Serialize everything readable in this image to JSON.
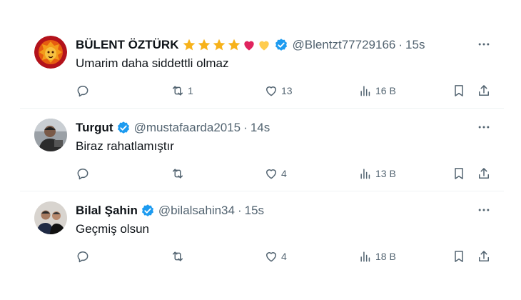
{
  "tweets": [
    {
      "name": "BÜLENT ÖZTÜRK",
      "badges": [
        "star",
        "star",
        "star",
        "star",
        "red-heart",
        "yellow-heart"
      ],
      "handle": "@Blentzt77729166",
      "time": "15s",
      "text": "Umarim daha siddettli olmaz",
      "replies": "",
      "retweets": "1",
      "likes": "13",
      "views": "16 B",
      "avatar": "lion-logo"
    },
    {
      "name": "Turgut",
      "badges": [],
      "handle": "@mustafaarda2015",
      "time": "14s",
      "text": "Biraz rahatlamıştır",
      "replies": "",
      "retweets": "",
      "likes": "4",
      "views": "13 B",
      "avatar": "photo"
    },
    {
      "name": "Bilal Şahin",
      "badges": [],
      "handle": "@bilalsahin34",
      "time": "15s",
      "text": "Geçmiş olsun",
      "replies": "",
      "retweets": "",
      "likes": "4",
      "views": "18 B",
      "avatar": "photo"
    }
  ],
  "separator": "·",
  "colors": {
    "text": "#0f1419",
    "muted": "#536471",
    "verified": "#1d9bf0",
    "star": "#f7b21a",
    "heart_red": "#e0245e",
    "heart_yellow": "#ffcc4d"
  },
  "icons": [
    "more-icon",
    "reply-icon",
    "retweet-icon",
    "like-icon",
    "views-icon",
    "bookmark-icon",
    "share-icon",
    "verified-icon"
  ]
}
